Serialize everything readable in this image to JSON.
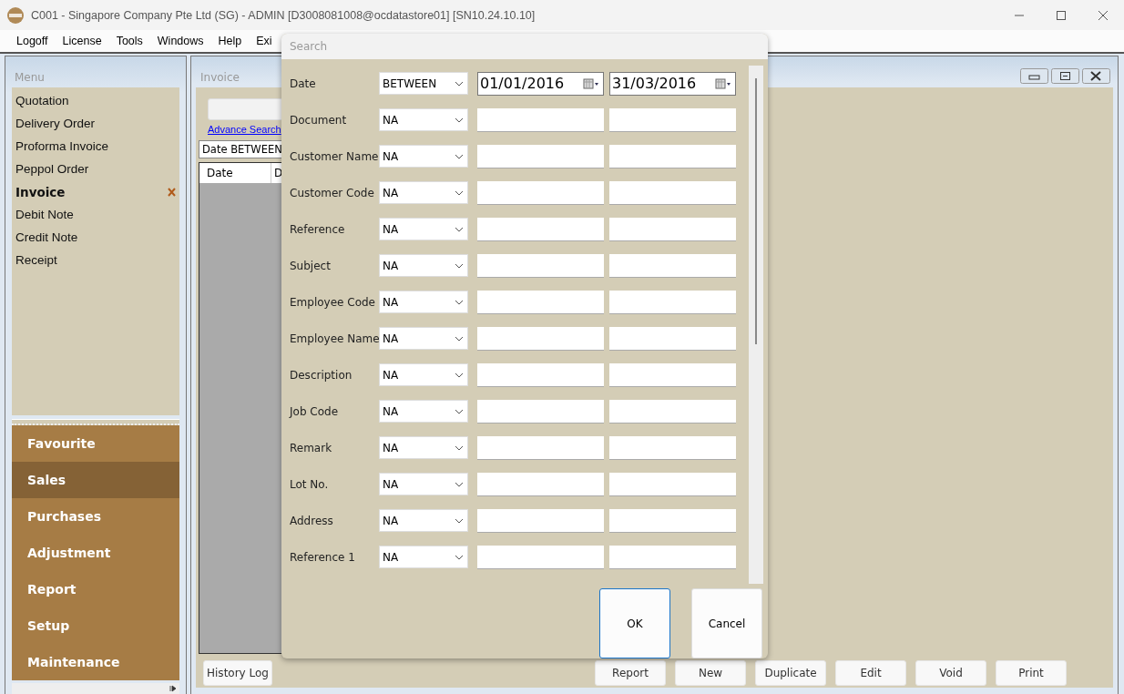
{
  "window": {
    "title": "C001 - Singapore Company Pte Ltd (SG) - ADMIN [D3008081008@ocdatastore01] [SN10.24.10.10]"
  },
  "menubar": [
    "Logoff",
    "License",
    "Tools",
    "Windows",
    "Help",
    "Exi"
  ],
  "sidebar": {
    "title": "Menu",
    "items": [
      {
        "label": "Quotation",
        "selected": false
      },
      {
        "label": "Delivery Order",
        "selected": false
      },
      {
        "label": "Proforma Invoice",
        "selected": false
      },
      {
        "label": "Peppol Order",
        "selected": false
      },
      {
        "label": "Invoice",
        "selected": true
      },
      {
        "label": "Debit Note",
        "selected": false
      },
      {
        "label": "Credit Note",
        "selected": false
      },
      {
        "label": "Receipt",
        "selected": false
      }
    ],
    "sections": [
      {
        "label": "Favourite",
        "selected": false
      },
      {
        "label": "Sales",
        "selected": true
      },
      {
        "label": "Purchases",
        "selected": false
      },
      {
        "label": "Adjustment",
        "selected": false
      },
      {
        "label": "Report",
        "selected": false
      },
      {
        "label": "Setup",
        "selected": false
      },
      {
        "label": "Maintenance",
        "selected": false
      }
    ]
  },
  "invoice": {
    "title": "Invoice",
    "advance_search": "Advance Search",
    "filter": "Date BETWEEN",
    "columns": [
      "Date",
      "D"
    ],
    "left_buttons": [
      "History Log"
    ],
    "buttons": [
      "Report",
      "New",
      "Duplicate",
      "Edit",
      "Void",
      "Print"
    ]
  },
  "dialog": {
    "title": "Search",
    "rows": [
      {
        "label": "Date",
        "operator": "BETWEEN",
        "kind": "date",
        "from": "01/01/2016",
        "to": "31/03/2016"
      },
      {
        "label": "Document",
        "operator": "NA",
        "kind": "text"
      },
      {
        "label": "Customer Name",
        "operator": "NA",
        "kind": "text"
      },
      {
        "label": "Customer Code",
        "operator": "NA",
        "kind": "text"
      },
      {
        "label": "Reference",
        "operator": "NA",
        "kind": "text"
      },
      {
        "label": "Subject",
        "operator": "NA",
        "kind": "text"
      },
      {
        "label": "Employee Code",
        "operator": "NA",
        "kind": "text"
      },
      {
        "label": "Employee Name",
        "operator": "NA",
        "kind": "text"
      },
      {
        "label": "Description",
        "operator": "NA",
        "kind": "text"
      },
      {
        "label": "Job Code",
        "operator": "NA",
        "kind": "text"
      },
      {
        "label": "Remark",
        "operator": "NA",
        "kind": "text"
      },
      {
        "label": "Lot No.",
        "operator": "NA",
        "kind": "text"
      },
      {
        "label": "Address",
        "operator": "NA",
        "kind": "text"
      },
      {
        "label": "Reference 1",
        "operator": "NA",
        "kind": "text"
      }
    ],
    "buttons": [
      {
        "label": "OK",
        "focused": true
      },
      {
        "label": "Cancel",
        "focused": false
      }
    ]
  }
}
